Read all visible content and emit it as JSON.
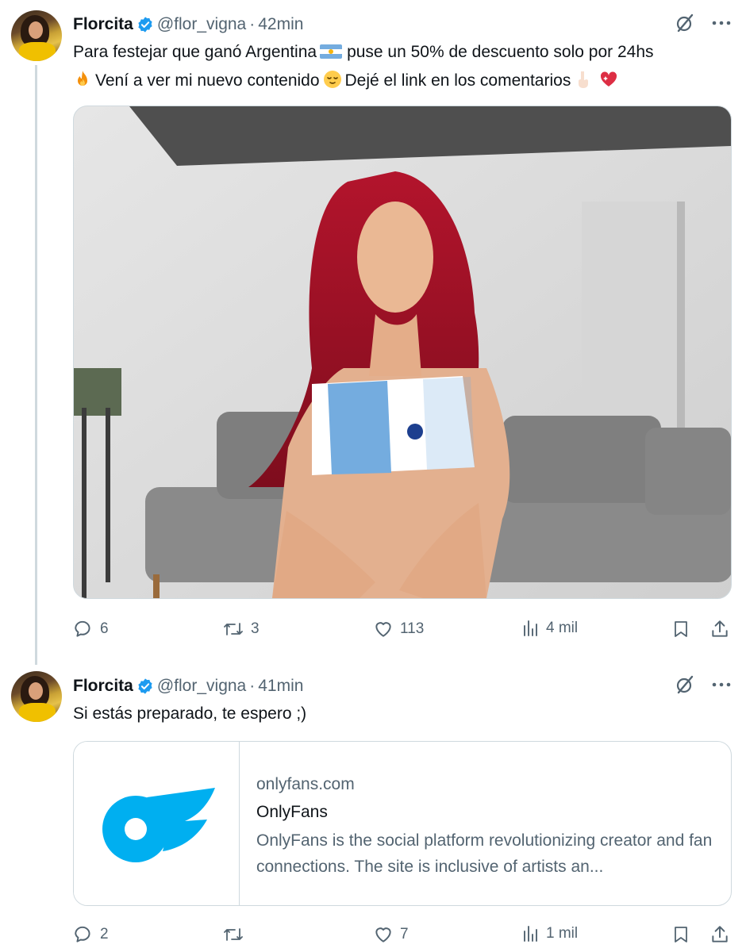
{
  "posts": [
    {
      "author_name": "Florcita",
      "handle": "@flor_vigna",
      "separator": "·",
      "time": "42min",
      "text_line1_a": "Para festejar que ganó Argentina",
      "text_line1_b": "puse un 50% de descuento solo por 24hs",
      "text_line2_a": "Vení a ver mi nuevo contenido",
      "text_line2_b": "Dejé el link en los comentarios",
      "media": {
        "type": "photo",
        "description_icon": "photo-woman-argentina-jersey"
      },
      "actions": {
        "replies": "6",
        "reposts": "3",
        "likes": "113",
        "views": "4 mil"
      }
    },
    {
      "author_name": "Florcita",
      "handle": "@flor_vigna",
      "separator": "·",
      "time": "41min",
      "text": "Si estás preparado, te espero ;)",
      "card": {
        "domain": "onlyfans.com",
        "title": "OnlyFans",
        "description": "OnlyFans is the social platform revolutionizing creator and fan connections. The site is inclusive of artists an...",
        "logo_icon": "onlyfans-logo-icon"
      },
      "actions": {
        "replies": "2",
        "reposts": "",
        "likes": "7",
        "views": "1 mil"
      }
    }
  ],
  "colors": {
    "accent": "#1d9bf0",
    "muted": "#536471",
    "text": "#0f1419",
    "border": "#cfd9de",
    "onlyfans": "#00aff0"
  }
}
